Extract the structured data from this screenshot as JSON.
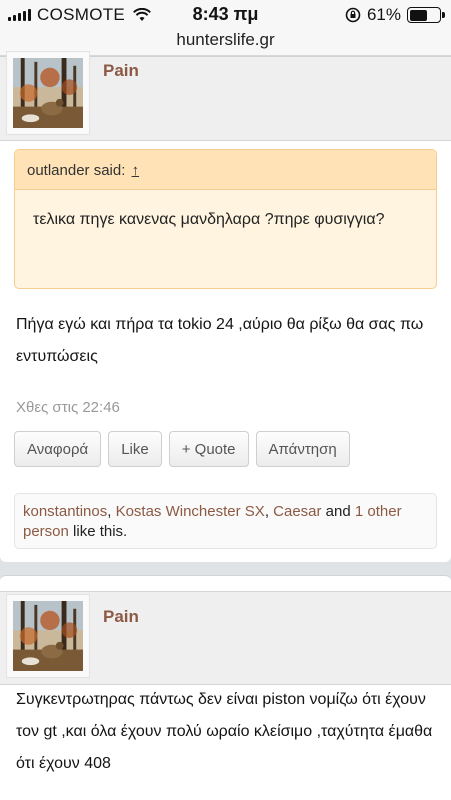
{
  "status": {
    "carrier": "COSMOTE",
    "time": "8:43 πμ",
    "battery": "61%",
    "battery_level": 0.61
  },
  "browser": {
    "url": "hunterslife.gr"
  },
  "post1": {
    "username": "Pain",
    "quote": {
      "author": "outlander said:",
      "arrow": "↑",
      "text": "τελικα πηγε κανενας μανδηλαρα ?πηρε φυσιγγια?"
    },
    "message": "Πήγα εγώ και πήρα τα tokio 24 ,αύριο θα ρίξω θα σας πω εντυπώσεις",
    "datetime": "Χθες στις 22:46",
    "actions": {
      "report": "Αναφορά",
      "like": "Like",
      "quote": "+ Quote",
      "reply": "Απάντηση"
    },
    "likes": {
      "user1": "konstantinos",
      "sep1": ", ",
      "user2": "Kostas Winchester SX",
      "sep2": ", ",
      "user3": "Caesar",
      "and": " and ",
      "others": "1 other person",
      "suffix": " like this."
    }
  },
  "post2": {
    "username": "Pain",
    "message": "Συγκεντρωτηρας πάντως δεν είναι piston νομίζω ότι έχουν τον gt ,και όλα έχουν πολύ ωραίο κλείσιμο ,ταχύτητα έμαθα ότι έχουν 408"
  }
}
